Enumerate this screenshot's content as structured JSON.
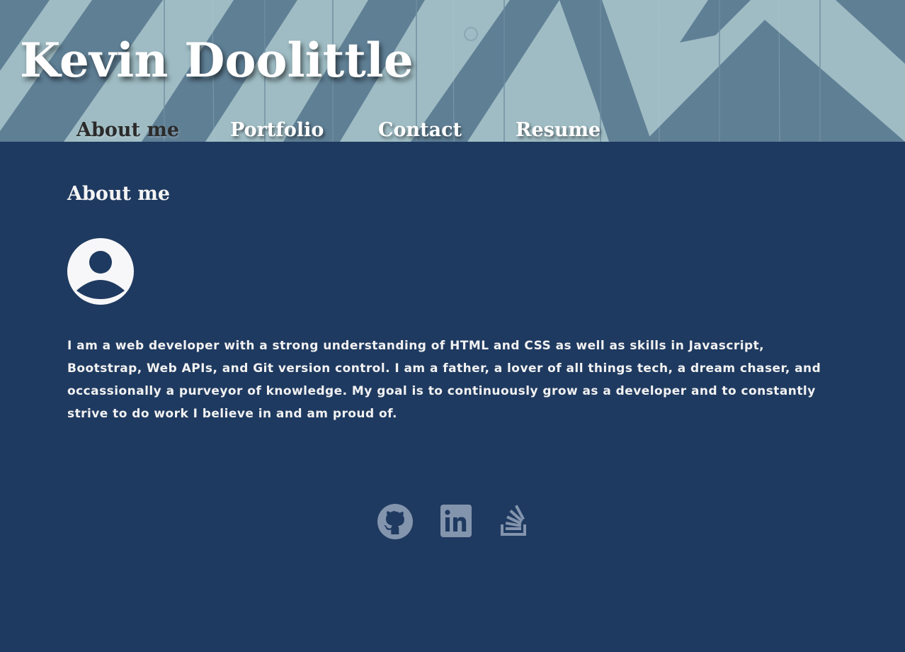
{
  "header": {
    "site_title": "Kevin Doolittle",
    "nav": [
      {
        "label": "About me",
        "active": true
      },
      {
        "label": "Portfolio",
        "active": false
      },
      {
        "label": "Contact",
        "active": false
      },
      {
        "label": "Resume",
        "active": false
      }
    ]
  },
  "about": {
    "heading": "About me",
    "avatar_icon": "user-circle-icon",
    "bio": "I am a web developer with a strong understanding of HTML and CSS as well as skills in Javascript, Bootstrap, Web APIs, and Git version control. I am a father, a lover of all things tech, a dream chaser, and occassionally a purveyor of knowledge. My goal is to continuously grow as a developer and to constantly strive to do work I believe in and am proud of."
  },
  "social": [
    {
      "icon": "github-icon"
    },
    {
      "icon": "linkedin-icon"
    },
    {
      "icon": "stackoverflow-icon"
    }
  ],
  "colors": {
    "background": "#1f3a60",
    "header_light": "#9fbcc4",
    "header_dark": "#5e7d93",
    "text": "#f2f2f2",
    "active_nav": "#2b2b2b",
    "social_icon": "#8394ad"
  }
}
